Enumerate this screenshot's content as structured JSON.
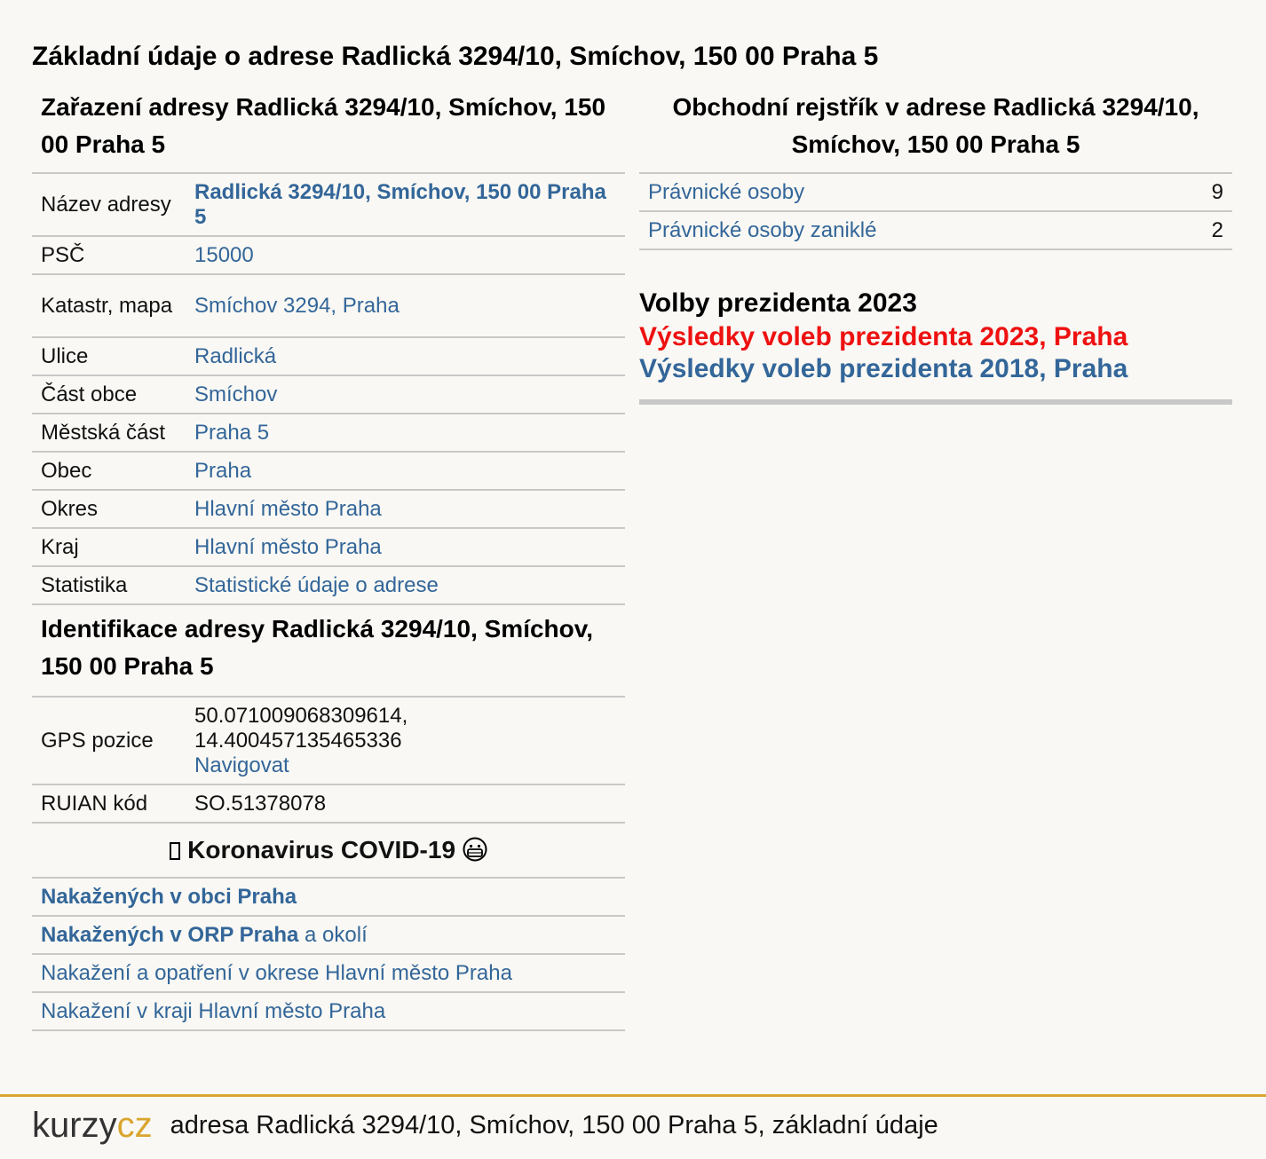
{
  "page": {
    "title": "Základní údaje o adrese Radlická 3294/10, Smíchov, 150 00 Praha 5"
  },
  "zarazeni": {
    "heading": "Zařazení adresy Radlická 3294/10, Smíchov, 150 00 Praha 5",
    "rows": [
      {
        "label": "Název adresy",
        "value": "Radlická 3294/10, Smíchov, 150 00 Praha 5"
      },
      {
        "label": "PSČ",
        "value": "15000"
      },
      {
        "label": "Katastr, mapa",
        "value": "Smíchov 3294, Praha"
      },
      {
        "label": "Ulice",
        "value": "Radlická"
      },
      {
        "label": "Část obce",
        "value": "Smíchov"
      },
      {
        "label": "Městská část",
        "value": "Praha 5"
      },
      {
        "label": "Obec",
        "value": "Praha"
      },
      {
        "label": "Okres",
        "value": "Hlavní město Praha"
      },
      {
        "label": "Kraj",
        "value": "Hlavní město Praha"
      },
      {
        "label": "Statistika",
        "value": "Statistické údaje o adrese"
      }
    ]
  },
  "identifikace": {
    "heading": "Identifikace adresy Radlická 3294/10, Smíchov, 150 00 Praha 5",
    "gps_label": "GPS pozice",
    "gps_lat": "50.071009068309614,",
    "gps_lon": "14.400457135465336",
    "navigate": "Navigovat",
    "ruian_label": "RUIAN kód",
    "ruian_value": "SO.51378078"
  },
  "covid": {
    "heading": "Koronavirus COVID-19",
    "links": [
      {
        "text": "Nakažených v obci Praha"
      },
      {
        "text_bold": "Nakažených v ORP Praha",
        "text_rest": " a okolí"
      },
      {
        "text": "Nakažení a opatření v okrese Hlavní město Praha"
      },
      {
        "text": "Nakažení v kraji Hlavní město Praha"
      }
    ]
  },
  "rejstrik": {
    "heading": "Obchodní rejstřík v adrese Radlická 3294/10, Smíchov, 150 00 Praha 5",
    "rows": [
      {
        "label": "Právnické osoby",
        "count": "9"
      },
      {
        "label": "Právnické osoby zaniklé",
        "count": "2"
      }
    ]
  },
  "volby": {
    "heading": "Volby prezidenta 2023",
    "link_2023": "Výsledky voleb prezidenta 2023, Praha",
    "link_2018": "Výsledky voleb prezidenta 2018, Praha"
  },
  "footer": {
    "logo_part1": "kurzy",
    "logo_part2": "cz",
    "text": "adresa Radlická 3294/10, Smíchov, 150 00 Praha 5, základní údaje"
  },
  "colors": {
    "link": "#336699",
    "highlight_red": "#ee1111",
    "accent_gold": "#d9a52e",
    "background": "#f9f8f4"
  }
}
